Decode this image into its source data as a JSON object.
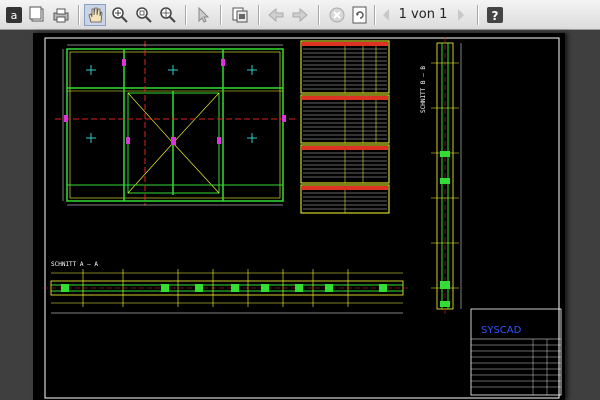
{
  "toolbar": {
    "page_display": "1 von 1",
    "buttons": [
      {
        "name": "app-menu-icon"
      },
      {
        "name": "single-page-icon"
      },
      {
        "name": "print-icon"
      },
      {
        "name": "pan-hand-icon"
      },
      {
        "name": "zoom-in-icon"
      },
      {
        "name": "zoom-region-icon"
      },
      {
        "name": "zoom-fit-icon"
      },
      {
        "name": "select-arrow-icon"
      },
      {
        "name": "copy-icon"
      },
      {
        "name": "back-arrow-icon"
      },
      {
        "name": "forward-arrow-icon"
      },
      {
        "name": "stop-icon"
      },
      {
        "name": "refresh-icon"
      },
      {
        "name": "prev-page-icon"
      },
      {
        "name": "next-page-icon"
      },
      {
        "name": "help-icon"
      }
    ]
  },
  "drawing": {
    "section_a_label": "SCHNITT A — A",
    "section_b_label": "SCHNITT B — B",
    "logo_text": "SYSCAD",
    "colors": {
      "frame": "#ffffff",
      "profile": "#33dd33",
      "accent": "#ffff33",
      "axis": "#dd2222",
      "cross": "#33cccc",
      "magenta": "#dd33dd",
      "logo": "#3355ff"
    }
  }
}
